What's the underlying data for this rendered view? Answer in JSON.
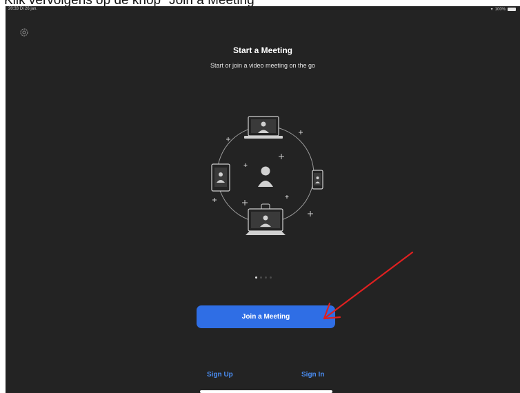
{
  "caption": "Klik vervolgens op de knop \"Join a Meeting\"",
  "status": {
    "time": "20:33",
    "date": "Di 26 jan.",
    "battery": "100%"
  },
  "icons": {
    "settings": "gear-icon",
    "wifi": "wifi-icon",
    "battery": "battery-icon"
  },
  "main": {
    "title": "Start a Meeting",
    "subtitle": "Start or join a video meeting on the go",
    "page_indicator": {
      "count": 4,
      "active": 0
    }
  },
  "buttons": {
    "join": "Join a Meeting"
  },
  "links": {
    "sign_up": "Sign Up",
    "sign_in": "Sign In"
  },
  "colors": {
    "background": "#232323",
    "accent_button": "#2f6ee5",
    "link": "#4a8cf0",
    "arrow": "#e02020"
  }
}
